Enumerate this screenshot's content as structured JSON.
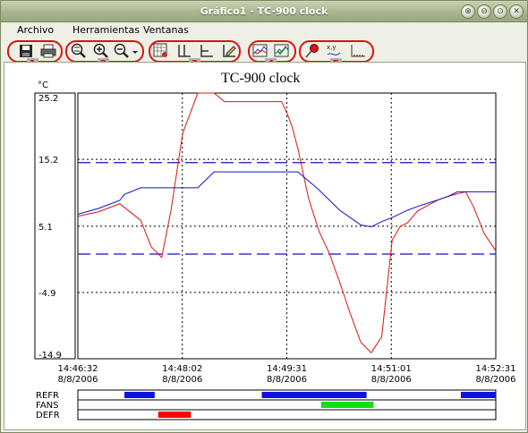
{
  "window": {
    "title": "Gráfico1 - TC-900 clock"
  },
  "window_buttons": [
    "⊕",
    "⊖",
    "⊙",
    "✕"
  ],
  "menu": [
    "Archivo",
    "Herramientas",
    "Ventanas"
  ],
  "toolbar": {
    "groups": [
      "1",
      "2",
      "3",
      "4",
      "5"
    ],
    "icons": [
      "save-icon",
      "print-icon",
      "zoom-fit-icon",
      "zoom-in-icon",
      "zoom-out-icon",
      "grid-icon",
      "axis-icon",
      "axis-alt-icon",
      "edit-icon",
      "chart-icon",
      "chart-check-icon",
      "pin-icon",
      "xy-icon",
      "scale-icon"
    ],
    "xy_label": "x,y"
  },
  "chart_data": {
    "type": "line",
    "title": "TC-900 clock",
    "yunit": "°C",
    "ylim": [
      -14.9,
      25.2
    ],
    "yticks": [
      25.2,
      15.2,
      5.1,
      -4.9,
      -14.9
    ],
    "xticks": [
      {
        "time": "14:46:32",
        "date": "8/8/2006"
      },
      {
        "time": "14:48:02",
        "date": "8/8/2006"
      },
      {
        "time": "14:49:31",
        "date": "8/8/2006"
      },
      {
        "time": "14:51:01",
        "date": "8/8/2006"
      },
      {
        "time": "14:52:31",
        "date": "8/8/2006"
      }
    ],
    "xlim": [
      0,
      359
    ],
    "setpoint_upper": 14.7,
    "setpoint_lower": 0.9,
    "series": [
      {
        "color": "#e01010",
        "x": [
          0,
          18,
          36,
          54,
          63,
          72,
          80,
          90,
          103,
          117,
          126,
          135,
          160,
          175,
          180,
          184,
          189,
          198,
          207,
          216,
          225,
          234,
          243,
          252,
          261,
          270,
          277,
          283,
          292,
          301,
          310,
          318,
          326,
          333,
          340,
          349,
          359
        ],
        "y": [
          6.6,
          7.3,
          8.5,
          6.0,
          2.0,
          0.4,
          7.5,
          19.1,
          25.2,
          25.2,
          23.9,
          23.9,
          23.9,
          23.9,
          22.0,
          20.1,
          16.8,
          9.4,
          4.4,
          1.0,
          -3.4,
          -8.1,
          -12.4,
          -14.0,
          -11.6,
          3.0,
          5.1,
          5.6,
          7.4,
          8.3,
          9.1,
          9.6,
          10.0,
          10.3,
          8.0,
          4.0,
          1.4
        ]
      },
      {
        "color": "#1010d0",
        "x": [
          0,
          18,
          36,
          40,
          54,
          72,
          90,
          103,
          117,
          126,
          135,
          160,
          175,
          189,
          207,
          225,
          243,
          252,
          261,
          270,
          277,
          283,
          292,
          301,
          310,
          318,
          326,
          333,
          340,
          349,
          359
        ],
        "y": [
          6.9,
          7.8,
          9.0,
          9.9,
          10.9,
          10.9,
          10.9,
          10.9,
          13.3,
          13.3,
          13.3,
          13.3,
          13.3,
          13.3,
          10.6,
          7.5,
          5.3,
          5.0,
          5.8,
          6.4,
          7.0,
          7.5,
          8.1,
          8.6,
          9.1,
          9.6,
          10.3,
          10.3,
          10.3,
          10.3,
          10.3
        ]
      }
    ],
    "channels": [
      {
        "name": "REFR",
        "color": "#1010e0",
        "segments": [
          [
            40,
            66
          ],
          [
            158,
            248
          ],
          [
            329,
            359
          ]
        ]
      },
      {
        "name": "FANS",
        "color": "#10e010",
        "segments": [
          [
            209,
            254
          ]
        ]
      },
      {
        "name": "DEFR",
        "color": "#ff0000",
        "segments": [
          [
            69,
            97
          ]
        ]
      }
    ]
  }
}
